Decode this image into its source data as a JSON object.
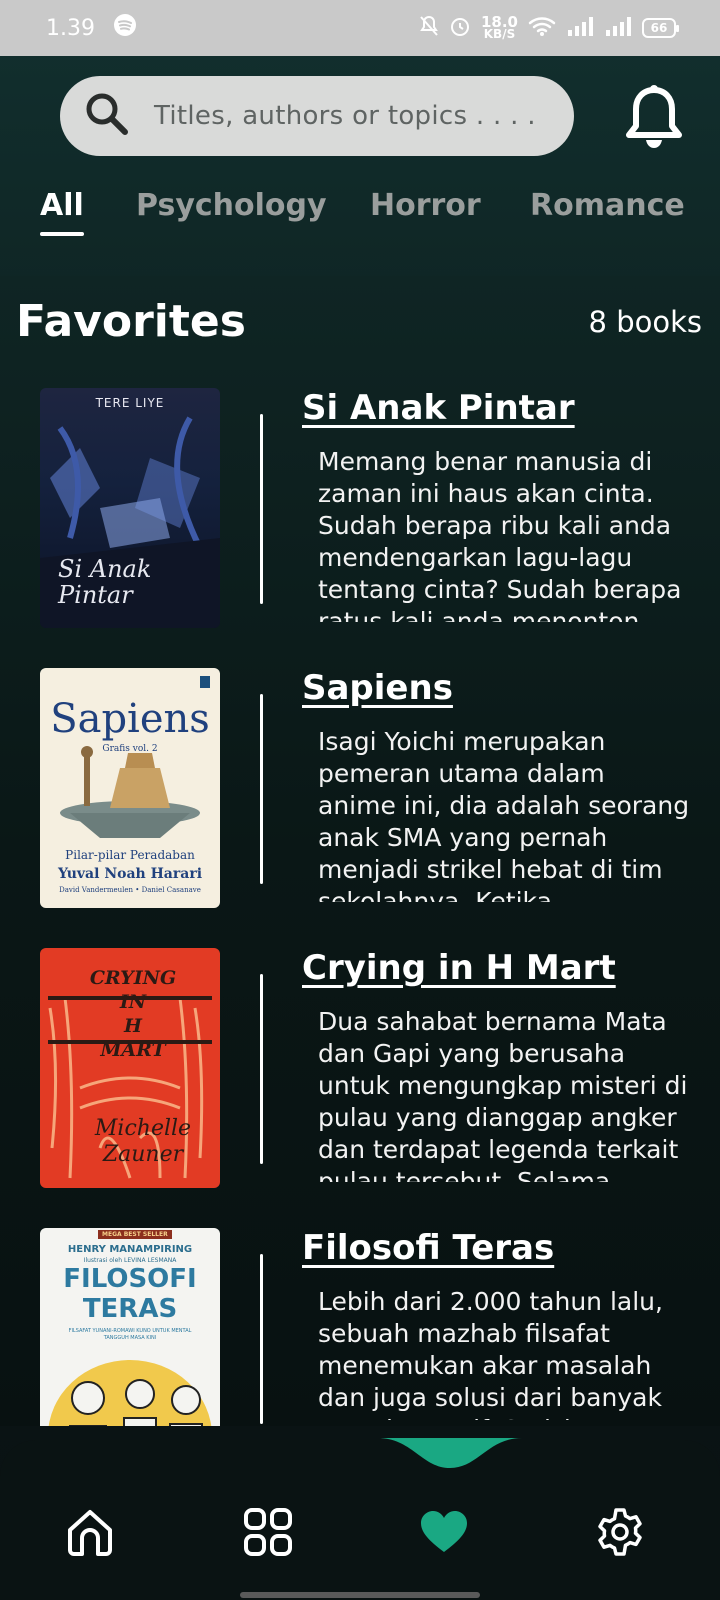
{
  "status_bar": {
    "time": "1.39",
    "net_speed_value": "18.0",
    "net_speed_unit": "KB/S",
    "battery": "66"
  },
  "search": {
    "placeholder": "Titles, authors or topics . . . ."
  },
  "tabs": [
    {
      "label": "All",
      "active": true
    },
    {
      "label": "Psychology",
      "active": false
    },
    {
      "label": "Horror",
      "active": false
    },
    {
      "label": "Romance",
      "active": false
    }
  ],
  "favorites": {
    "title": "Favorites",
    "count_label": "8 books",
    "books": [
      {
        "title": "Si Anak Pintar",
        "description": "Memang benar manusia di zaman ini haus akan cinta. Sudah berapa ribu kali anda mendengarkan lagu-lagu tentang cinta? Sudah berapa ratus kali anda menonton film",
        "cover": {
          "author": "TERE LIYE",
          "title": "Si Anak Pintar"
        }
      },
      {
        "title": "Sapiens",
        "description": "Isagi Yoichi merupakan pemeran utama dalam anime ini, dia adalah seorang anak SMA yang pernah menjadi strikel hebat di tim sekolahnya. Ketika",
        "cover": {
          "title": "Sapiens",
          "subtitle": "Grafis vol. 2",
          "tagline": "Pilar-pilar Peradaban",
          "author": "Yuval Noah Harari",
          "credits": "David Vandermeulen • Daniel Casanave"
        }
      },
      {
        "title": "Crying in H Mart",
        "description": "Dua sahabat bernama Mata dan Gapi yang berusaha untuk mengungkap misteri di pulau yang dianggap angker dan terdapat legenda terkait pulau tersebut. Selama",
        "cover": {
          "title_line1": "CRYING",
          "title_line2": "IN",
          "title_line3": "H",
          "title_line4": "MART",
          "author_line1": "Michelle",
          "author_line2": "Zauner"
        }
      },
      {
        "title": "Filosofi Teras",
        "description": "Lebih dari 2.000 tahun lalu, sebuah mazhab filsafat menemukan akar masalah dan juga solusi dari banyak emosi negatif. Stoisisme, atau",
        "cover": {
          "badge": "MEGA BEST SELLER",
          "author": "HENRY MANAMPIRING",
          "illustrator": "Ilustrasi oleh LEVINA LESMANA",
          "title_line1": "FILOSOFI",
          "title_line2": "TERAS",
          "tagline": "FILSAFAT YUNANI-ROMAWI KUNO UNTUK MENTAL TANGGUH MASA KINI"
        }
      }
    ]
  },
  "nav": {
    "items": [
      "home-icon",
      "grid-icon",
      "heart-icon",
      "gear-icon"
    ],
    "active_index": 2,
    "accent": "#1aa883"
  }
}
